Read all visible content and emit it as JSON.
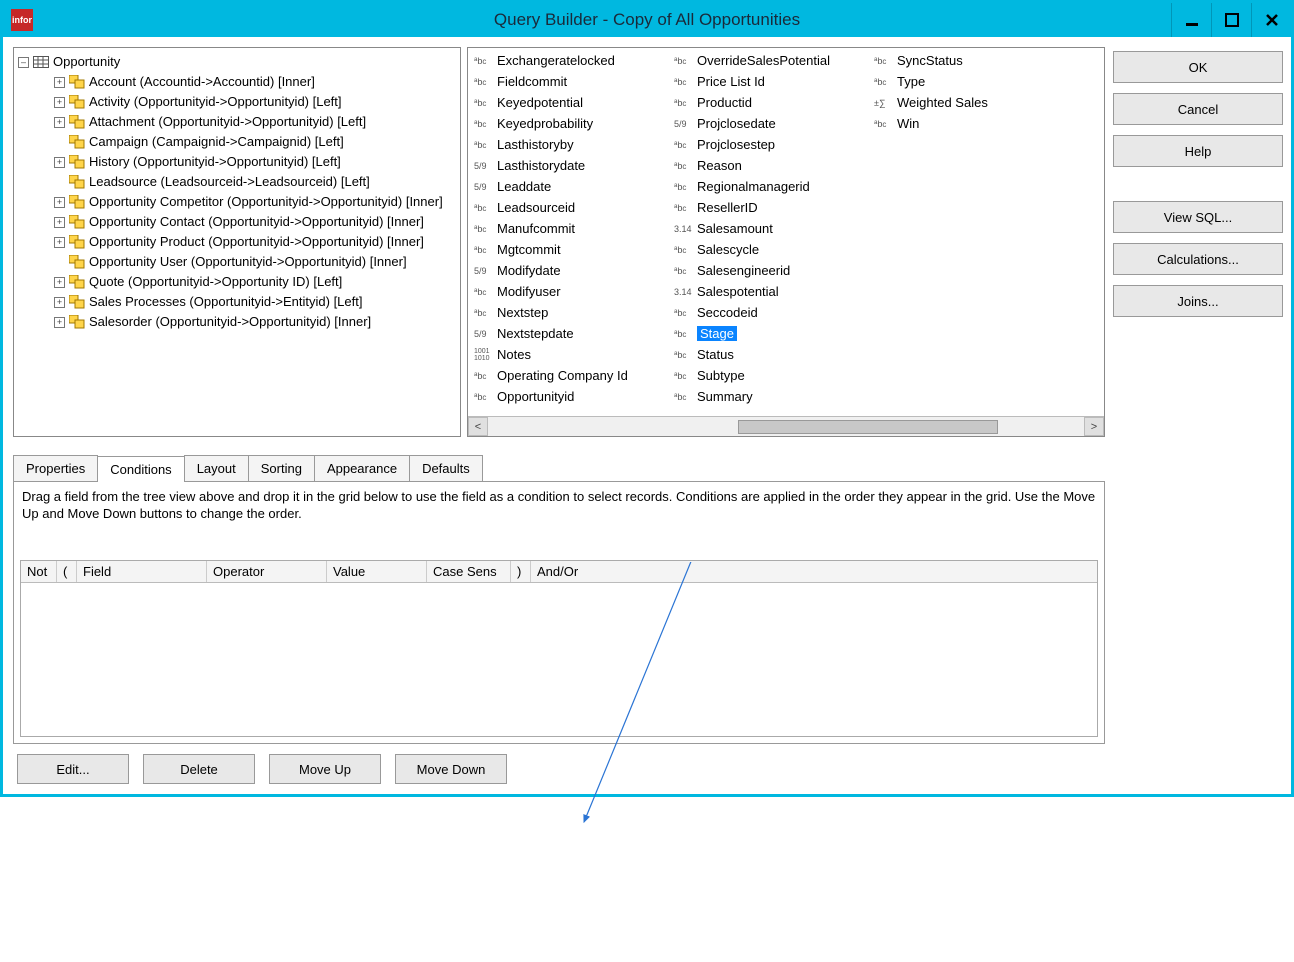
{
  "window": {
    "title": "Query Builder - Copy of All Opportunities",
    "app_icon_label": "infor"
  },
  "buttons": {
    "ok": "OK",
    "cancel": "Cancel",
    "help": "Help",
    "view_sql": "View SQL...",
    "calculations": "Calculations...",
    "joins": "Joins...",
    "edit": "Edit...",
    "delete": "Delete",
    "move_up": "Move Up",
    "move_down": "Move Down"
  },
  "tree": {
    "root": "Opportunity",
    "children": [
      {
        "exp": "+",
        "label": "Account (Accountid->Accountid) [Inner]"
      },
      {
        "exp": "+",
        "label": "Activity (Opportunityid->Opportunityid) [Left]"
      },
      {
        "exp": "+",
        "label": "Attachment (Opportunityid->Opportunityid) [Left]"
      },
      {
        "exp": "",
        "label": "Campaign (Campaignid->Campaignid) [Left]"
      },
      {
        "exp": "+",
        "label": "History (Opportunityid->Opportunityid) [Left]"
      },
      {
        "exp": "",
        "label": "Leadsource (Leadsourceid->Leadsourceid) [Left]"
      },
      {
        "exp": "+",
        "label": "Opportunity Competitor (Opportunityid->Opportunityid) [Inner]"
      },
      {
        "exp": "+",
        "label": "Opportunity Contact (Opportunityid->Opportunityid) [Inner]"
      },
      {
        "exp": "+",
        "label": "Opportunity Product (Opportunityid->Opportunityid) [Inner]"
      },
      {
        "exp": "",
        "label": "Opportunity User (Opportunityid->Opportunityid) [Inner]"
      },
      {
        "exp": "+",
        "label": "Quote (Opportunityid->Opportunity ID) [Left]"
      },
      {
        "exp": "+",
        "label": "Sales Processes (Opportunityid->Entityid) [Left]"
      },
      {
        "exp": "+",
        "label": "Salesorder (Opportunityid->Opportunityid) [Inner]"
      }
    ]
  },
  "fields": {
    "col1": [
      {
        "t": "abc",
        "n": "Exchangeratelocked"
      },
      {
        "t": "abc",
        "n": "Fieldcommit"
      },
      {
        "t": "abc",
        "n": "Keyedpotential"
      },
      {
        "t": "abc",
        "n": "Keyedprobability"
      },
      {
        "t": "abc",
        "n": "Lasthistoryby"
      },
      {
        "t": "date",
        "n": "Lasthistorydate"
      },
      {
        "t": "date",
        "n": "Leaddate"
      },
      {
        "t": "abc",
        "n": "Leadsourceid"
      },
      {
        "t": "abc",
        "n": "Manufcommit"
      },
      {
        "t": "abc",
        "n": "Mgtcommit"
      },
      {
        "t": "date",
        "n": "Modifydate"
      },
      {
        "t": "abc",
        "n": "Modifyuser"
      },
      {
        "t": "abc",
        "n": "Nextstep"
      },
      {
        "t": "date",
        "n": "Nextstepdate"
      },
      {
        "t": "bin",
        "n": "Notes"
      },
      {
        "t": "abc",
        "n": "Operating Company Id"
      },
      {
        "t": "abc",
        "n": "Opportunityid"
      }
    ],
    "col2": [
      {
        "t": "abc",
        "n": "OverrideSalesPotential"
      },
      {
        "t": "abc",
        "n": "Price List Id"
      },
      {
        "t": "abc",
        "n": "Productid"
      },
      {
        "t": "date",
        "n": "Projclosedate"
      },
      {
        "t": "abc",
        "n": "Projclosestep"
      },
      {
        "t": "abc",
        "n": "Reason"
      },
      {
        "t": "abc",
        "n": "Regionalmanagerid"
      },
      {
        "t": "abc",
        "n": "ResellerID"
      },
      {
        "t": "num",
        "n": "Salesamount"
      },
      {
        "t": "abc",
        "n": "Salescycle"
      },
      {
        "t": "abc",
        "n": "Salesengineerid"
      },
      {
        "t": "num",
        "n": "Salespotential"
      },
      {
        "t": "abc",
        "n": "Seccodeid"
      },
      {
        "t": "abc",
        "n": "Stage",
        "sel": true
      },
      {
        "t": "abc",
        "n": "Status"
      },
      {
        "t": "abc",
        "n": "Subtype"
      },
      {
        "t": "abc",
        "n": "Summary"
      }
    ],
    "col3": [
      {
        "t": "abc",
        "n": "SyncStatus"
      },
      {
        "t": "abc",
        "n": "Type"
      },
      {
        "t": "calc",
        "n": "Weighted Sales"
      },
      {
        "t": "abc",
        "n": "Win"
      }
    ]
  },
  "tabs": [
    "Properties",
    "Conditions",
    "Layout",
    "Sorting",
    "Appearance",
    "Defaults"
  ],
  "active_tab": 1,
  "conditions": {
    "instructions": "Drag a field from the tree view above and drop it in the grid below to use the field as a condition to select records.  Conditions are applied in the order they appear in the grid.  Use the Move Up and Move Down buttons to change the order.",
    "headers": {
      "not": "Not",
      "lp": "(",
      "field": "Field",
      "op": "Operator",
      "val": "Value",
      "cs": "Case Sens",
      "rp": ")",
      "ao": "And/Or"
    }
  },
  "type_glyphs": {
    "abc": "ᵃbc",
    "date": "5/9",
    "num": "3.14",
    "bin": "1001\n1010",
    "calc": "±∑"
  }
}
